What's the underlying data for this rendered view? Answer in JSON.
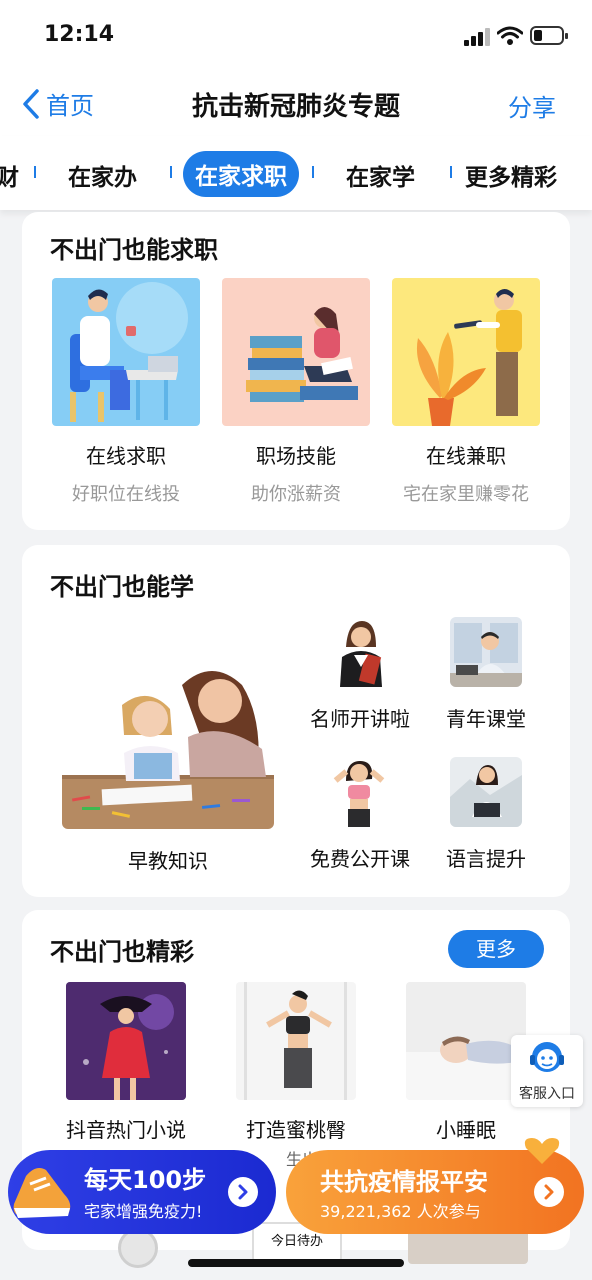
{
  "status": {
    "time": "12:14"
  },
  "nav": {
    "back_label": "首页",
    "title": "抗击新冠肺炎专题",
    "share_label": "分享"
  },
  "tabs": [
    "财",
    "在家办",
    "在家求职",
    "在家学",
    "更多精彩"
  ],
  "job_section": {
    "title": "不出门也能求职",
    "items": [
      {
        "label": "在线求职",
        "sub": "好职位在线投"
      },
      {
        "label": "职场技能",
        "sub": "助你涨薪资"
      },
      {
        "label": "在线兼职",
        "sub": "宅在家里赚零花"
      }
    ]
  },
  "learn_section": {
    "title": "不出门也能学",
    "feature_label": "早教知识",
    "items": [
      "名师开讲啦",
      "青年课堂",
      "免费公开课",
      "语言提升"
    ]
  },
  "fun_section": {
    "title": "不出门也精彩",
    "more_label": "更多",
    "items": [
      "抖音热门小说",
      "打造蜜桃臀",
      "小睡眠"
    ],
    "peek_text": "今日待办"
  },
  "customer_service": {
    "label": "客服入口"
  },
  "banners": {
    "steps": {
      "title": "每天100步",
      "sub": "宅家增强免疫力!"
    },
    "report": {
      "title": "共抗疫情报平安",
      "sub": "39,221,362 人次参与"
    }
  },
  "colors": {
    "accent": "#1e7ce6",
    "orange": "#f58220"
  }
}
